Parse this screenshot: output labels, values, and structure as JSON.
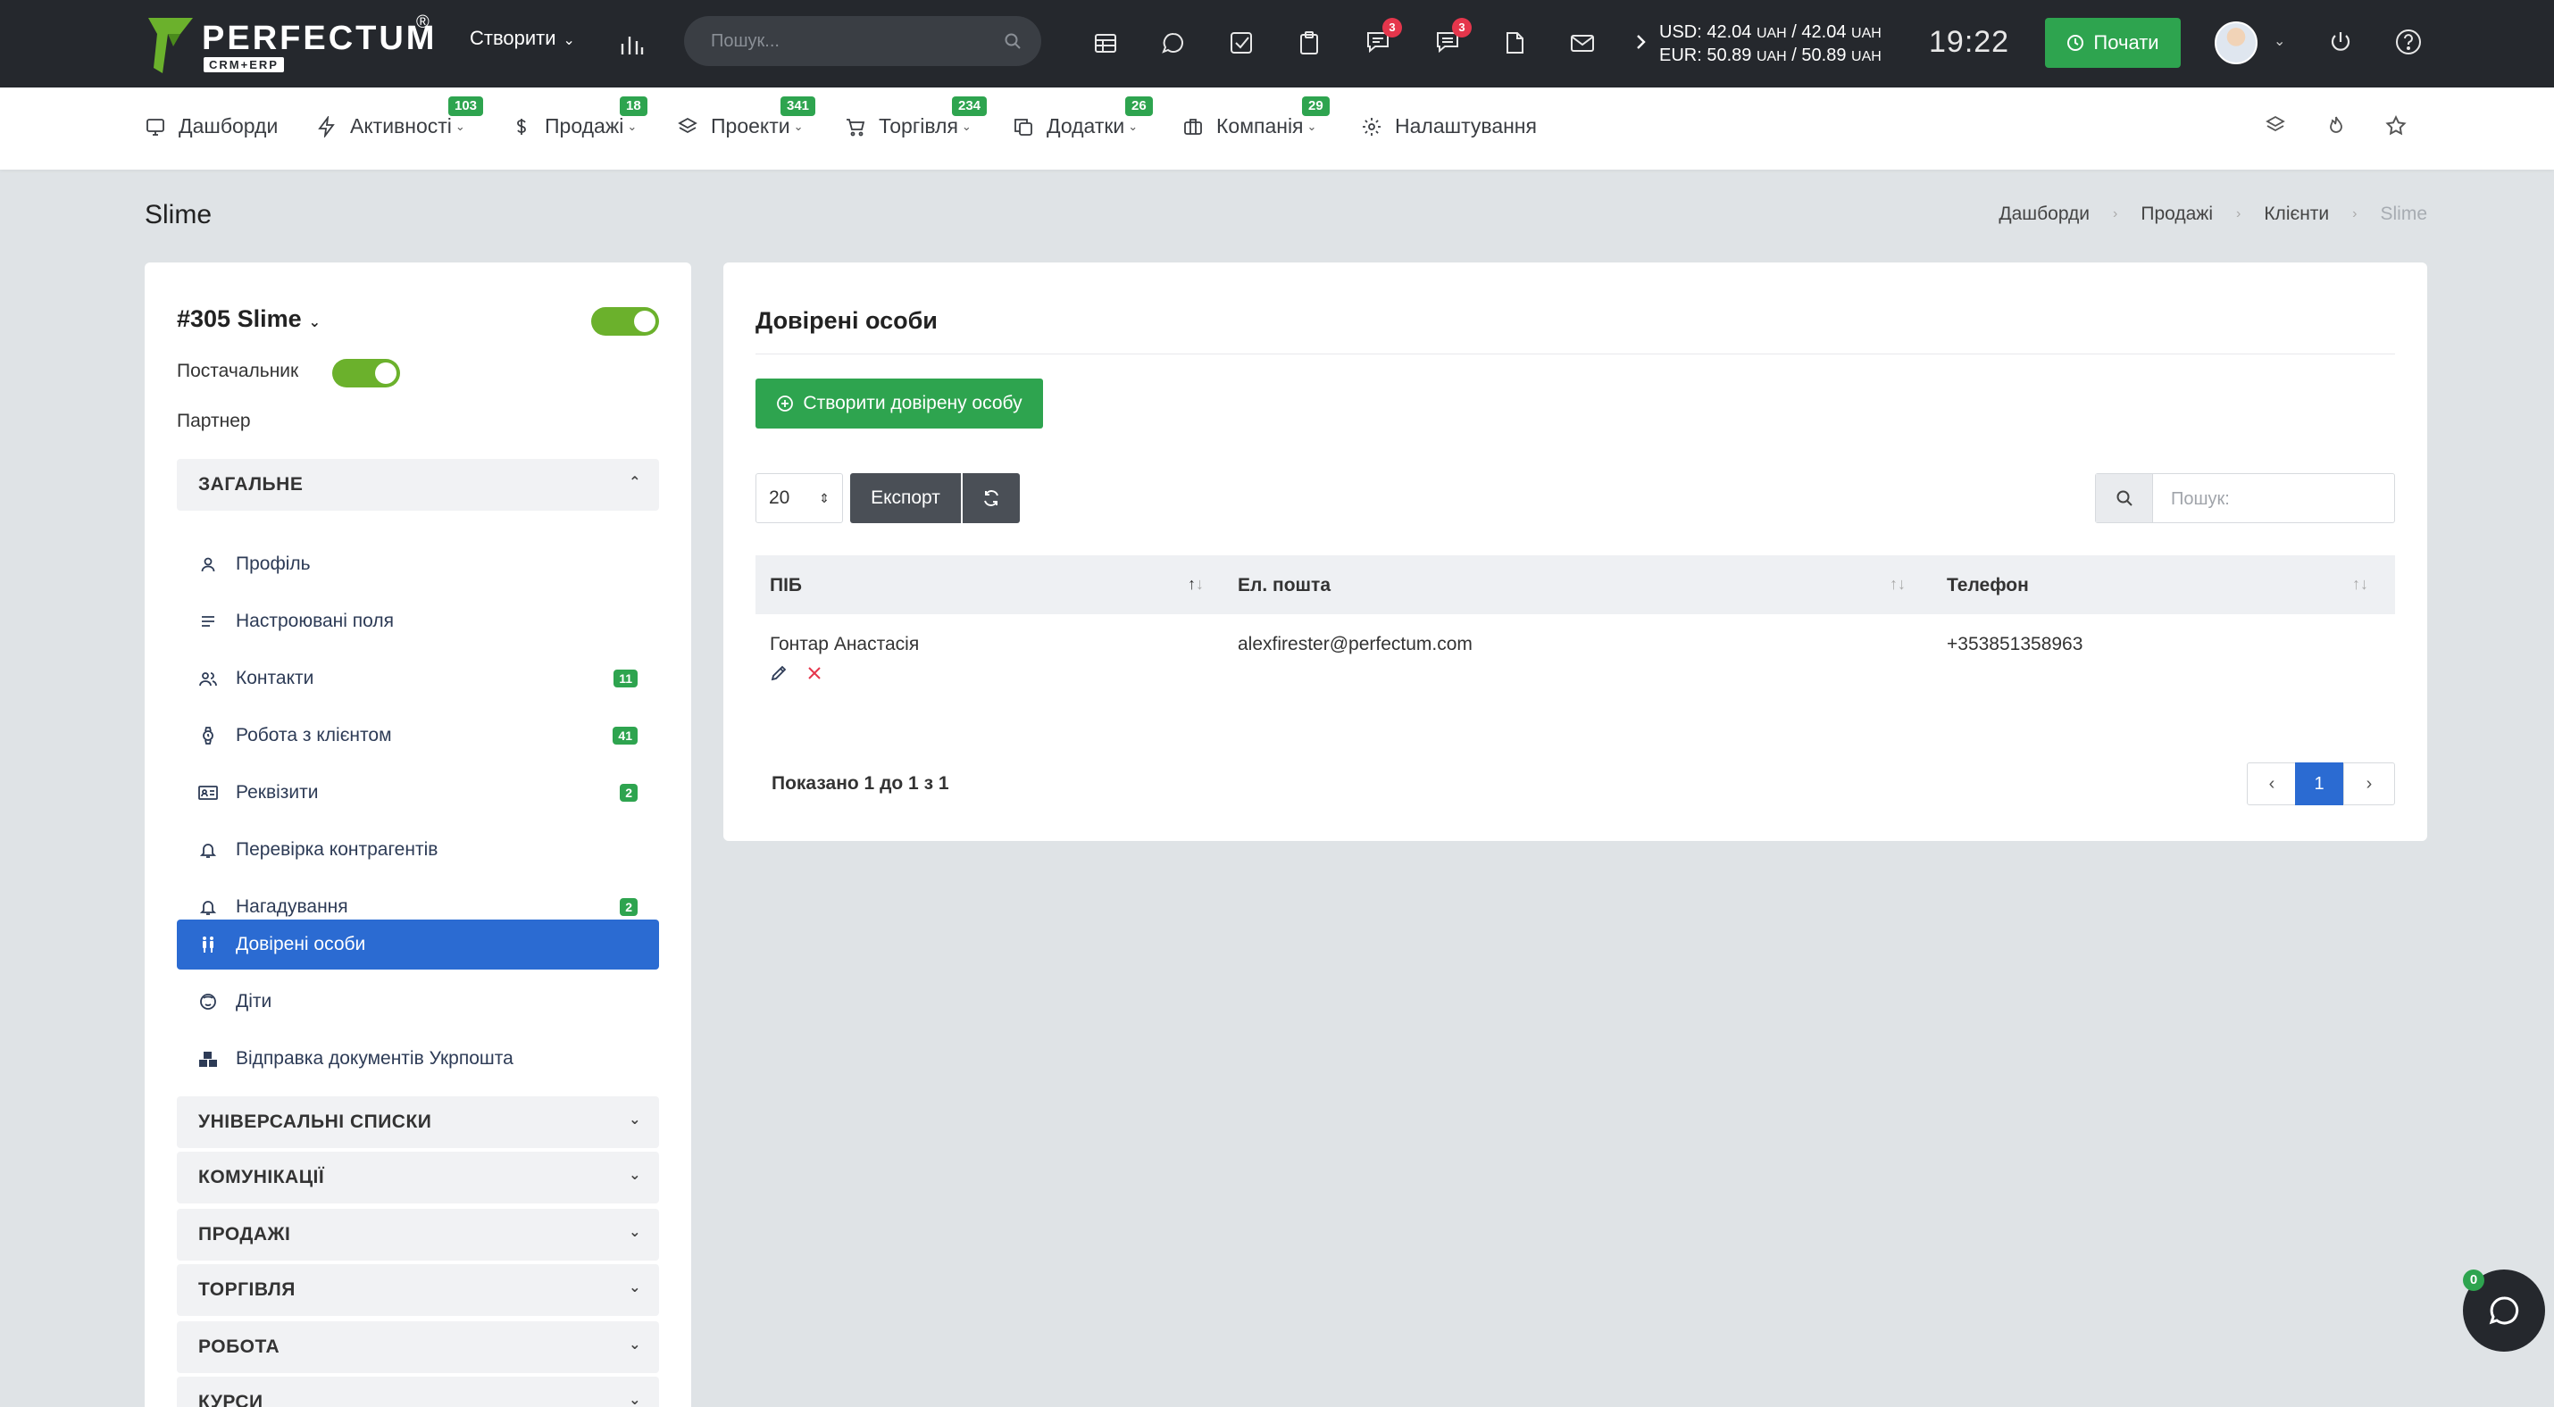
{
  "topbar": {
    "logo": {
      "name": "PERFECTUM",
      "reg": "®",
      "sub": "CRM+ERP"
    },
    "create_label": "Створити",
    "search_placeholder": "Пошук...",
    "badges": {
      "chat": "3",
      "messages": "3"
    },
    "rates": {
      "usd": "USD: 42.04",
      "usd_unit1": "UAH",
      "usd_sep": "/ 42.04",
      "usd_unit2": "UAH",
      "eur": "EUR: 50.89",
      "eur_unit1": "UAH",
      "eur_sep": "/ 50.89",
      "eur_unit2": "UAH"
    },
    "time": "19:22",
    "start_label": "Почати"
  },
  "nav": {
    "items": [
      {
        "label": "Дашборди",
        "icon": "monitor-icon"
      },
      {
        "label": "Активності",
        "badge": "103",
        "icon": "bolt-icon"
      },
      {
        "label": "Продажі",
        "badge": "18",
        "icon": "dollar-icon"
      },
      {
        "label": "Проекти",
        "badge": "341",
        "icon": "layers-icon"
      },
      {
        "label": "Торгівля",
        "badge": "234",
        "icon": "cart-icon"
      },
      {
        "label": "Додатки",
        "badge": "26",
        "icon": "copy-icon"
      },
      {
        "label": "Компанія",
        "badge": "29",
        "icon": "briefcase-icon"
      },
      {
        "label": "Налаштування",
        "icon": "gear-icon"
      }
    ]
  },
  "page": {
    "title": "Slime",
    "breadcrumb": [
      "Дашборди",
      "Продажі",
      "Клієнти",
      "Slime"
    ]
  },
  "client": {
    "name": "#305 Slime",
    "supplier_label": "Постачальник",
    "partner_label": "Партнер",
    "general_section": "ЗАГАЛЬНЕ",
    "menu": [
      {
        "label": "Профіль",
        "icon": "user-icon"
      },
      {
        "label": "Настроювані поля",
        "icon": "lines-icon"
      },
      {
        "label": "Контакти",
        "icon": "users-icon",
        "badge": "11"
      },
      {
        "label": "Робота з клієнтом",
        "icon": "watch-icon",
        "badge": "41"
      },
      {
        "label": "Реквізити",
        "icon": "id-card-icon",
        "badge": "2"
      },
      {
        "label": "Перевірка контрагентів",
        "icon": "bell-icon"
      },
      {
        "label": "Нагадування",
        "icon": "bell-icon",
        "badge": "2"
      },
      {
        "label": "Довірені особи",
        "icon": "persons-icon",
        "active": true
      },
      {
        "label": "Діти",
        "icon": "child-icon"
      },
      {
        "label": "Відправка документів Укрпошта",
        "icon": "boxes-icon"
      }
    ],
    "sections": [
      "УНІВЕРСАЛЬНІ СПИСКИ",
      "КОМУНІКАЦІЇ",
      "ПРОДАЖІ",
      "ТОРГІВЛЯ",
      "РОБОТА",
      "КУРСИ"
    ]
  },
  "main": {
    "title": "Довірені особи",
    "create_btn": "Створити довірену особу",
    "page_size": "20",
    "export_btn": "Експорт",
    "search_placeholder": "Пошук:",
    "columns": [
      "ПІБ",
      "Ел. пошта",
      "Телефон"
    ],
    "rows": [
      {
        "name": "Гонтар Анастасія",
        "email": "alexfirester@perfectum.com",
        "phone": "+353851358963"
      }
    ],
    "info": "Показано 1 до 1 з 1",
    "current_page": "1"
  },
  "chat": {
    "badge": "0"
  },
  "colors": {
    "accent_green": "#2ea44f",
    "active_blue": "#2b6bd2",
    "topbar": "#25282d"
  }
}
